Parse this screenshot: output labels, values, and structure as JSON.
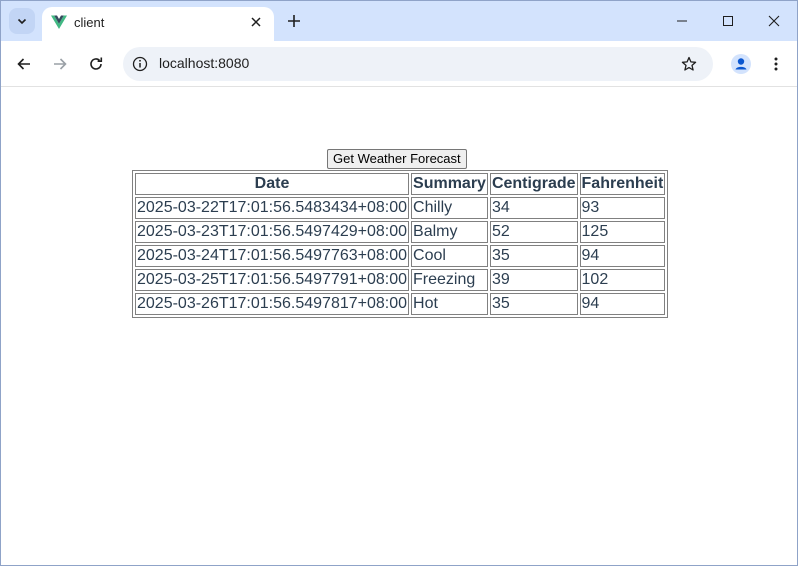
{
  "browser": {
    "tab": {
      "title": "client",
      "close_glyph": "✕"
    },
    "new_tab_glyph": "+",
    "address": {
      "url": "localhost:8080"
    },
    "icons": {
      "tab_search": "chevron-down-icon",
      "favicon": "vue-logo-icon",
      "back": "arrow-left-icon",
      "forward": "arrow-right-icon",
      "reload": "reload-icon",
      "site_info": "info-icon",
      "bookmark": "star-icon",
      "profile": "profile-icon",
      "menu": "kebab-menu-icon",
      "minimize": "minimize-icon",
      "maximize": "maximize-icon",
      "close": "close-icon"
    },
    "colors": {
      "tabstrip": "#d3e3fd",
      "omnibox": "#eef2f8",
      "profile_accent": "#0b57d0"
    }
  },
  "page": {
    "button_label": "Get Weather Forecast",
    "table": {
      "headers": [
        "Date",
        "Summary",
        "Centigrade",
        "Fahrenheit"
      ],
      "rows": [
        [
          "2025-03-22T17:01:56.5483434+08:00",
          "Chilly",
          "34",
          "93"
        ],
        [
          "2025-03-23T17:01:56.5497429+08:00",
          "Balmy",
          "52",
          "125"
        ],
        [
          "2025-03-24T17:01:56.5497763+08:00",
          "Cool",
          "35",
          "94"
        ],
        [
          "2025-03-25T17:01:56.5497791+08:00",
          "Freezing",
          "39",
          "102"
        ],
        [
          "2025-03-26T17:01:56.5497817+08:00",
          "Hot",
          "35",
          "94"
        ]
      ]
    },
    "colors": {
      "table_text": "#2c3e50",
      "vue_green": "#41b883",
      "vue_dark": "#34495e"
    }
  }
}
